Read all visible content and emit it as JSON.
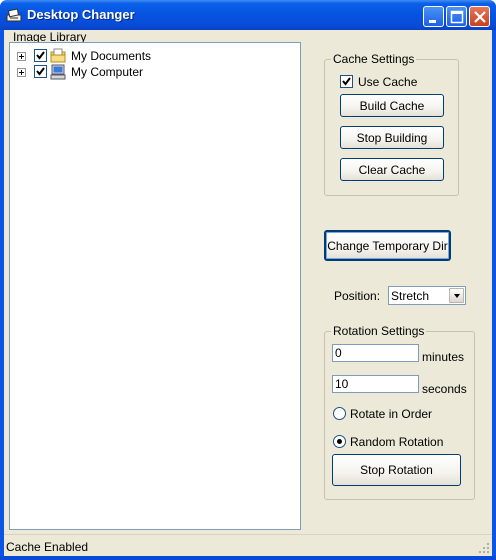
{
  "window": {
    "title": "Desktop Changer"
  },
  "image_library": {
    "label": "Image Library",
    "items": [
      {
        "label": "My Documents",
        "checked": true
      },
      {
        "label": "My Computer",
        "checked": true
      }
    ]
  },
  "cache_settings": {
    "label": "Cache Settings",
    "use_cache_label": "Use Cache",
    "use_cache_checked": true,
    "build_label": "Build Cache",
    "stop_label": "Stop Building",
    "clear_label": "Clear Cache"
  },
  "change_temp_dir_label": "Change Temporary Dir",
  "position": {
    "label": "Position:",
    "value": "Stretch"
  },
  "rotation_settings": {
    "label": "Rotation Settings",
    "minutes_value": "0",
    "minutes_label": "minutes",
    "seconds_value": "10",
    "seconds_label": "seconds",
    "rotate_in_order_label": "Rotate in Order",
    "random_rotation_label": "Random Rotation",
    "selected_mode": "Random Rotation",
    "stop_rotation_label": "Stop Rotation"
  },
  "status": {
    "text": "Cache Enabled"
  },
  "colors": {
    "titlebar": "#0553e0",
    "client_bg": "#ece9d8",
    "control_border": "#003c74"
  }
}
